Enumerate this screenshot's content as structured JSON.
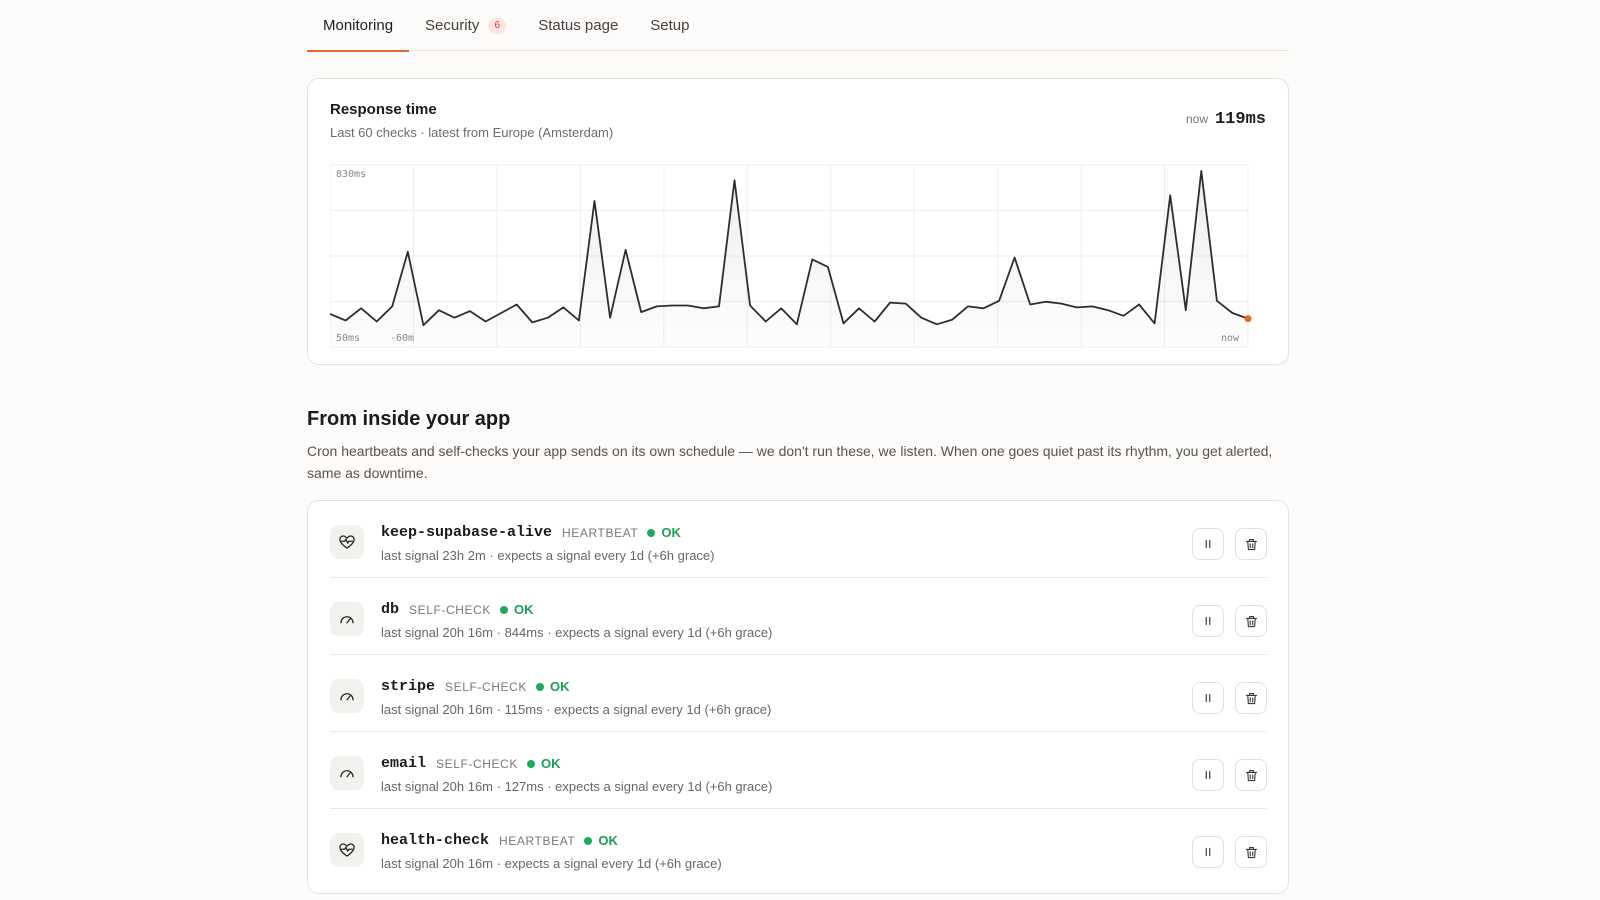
{
  "tabs": [
    {
      "label": "Monitoring",
      "active": true
    },
    {
      "label": "Security",
      "badge": "6"
    },
    {
      "label": "Status page"
    },
    {
      "label": "Setup"
    }
  ],
  "response_time": {
    "title": "Response time",
    "subtitle": "Last 60 checks · latest from Europe (Amsterdam)",
    "now_label": "now",
    "now_value": "119ms"
  },
  "chart_data": {
    "type": "line",
    "y_max_label": "830ms",
    "y_min_label": "50ms",
    "x_start_label": "-60m",
    "x_end_label": "now",
    "ylim": [
      50,
      830
    ],
    "grid": true,
    "values": [
      130,
      95,
      160,
      90,
      170,
      460,
      70,
      150,
      110,
      145,
      90,
      135,
      180,
      85,
      110,
      165,
      95,
      730,
      110,
      470,
      140,
      170,
      175,
      175,
      160,
      170,
      840,
      175,
      90,
      160,
      75,
      420,
      380,
      80,
      160,
      90,
      190,
      185,
      110,
      75,
      100,
      170,
      160,
      200,
      430,
      180,
      195,
      185,
      165,
      170,
      150,
      120,
      180,
      80,
      760,
      150,
      890,
      200,
      135,
      105
    ],
    "last_point_color": "#e4672d"
  },
  "section": {
    "title": "From inside your app",
    "description": "Cron heartbeats and self-checks your app sends on its own schedule — we don't run these, we listen. When one goes quiet past its rhythm, you get alerted, same as downtime."
  },
  "checks": [
    {
      "name": "keep-supabase-alive",
      "kind": "HEARTBEAT",
      "status": "OK",
      "icon": "heartbeat-icon",
      "detail": "last signal 23h 2m · expects a signal every 1d (+6h grace)"
    },
    {
      "name": "db",
      "kind": "SELF-CHECK",
      "status": "OK",
      "icon": "gauge-icon",
      "detail": "last signal 20h 16m · 844ms · expects a signal every 1d (+6h grace)"
    },
    {
      "name": "stripe",
      "kind": "SELF-CHECK",
      "status": "OK",
      "icon": "gauge-icon",
      "detail": "last signal 20h 16m · 115ms · expects a signal every 1d (+6h grace)"
    },
    {
      "name": "email",
      "kind": "SELF-CHECK",
      "status": "OK",
      "icon": "gauge-icon",
      "detail": "last signal 20h 16m · 127ms · expects a signal every 1d (+6h grace)"
    },
    {
      "name": "health-check",
      "kind": "HEARTBEAT",
      "status": "OK",
      "icon": "heartbeat-icon",
      "detail": "last signal 20h 16m · expects a signal every 1d (+6h grace)"
    }
  ],
  "colors": {
    "accent": "#e4672d",
    "ok": "#23a75f",
    "badge_bg": "#fbe3df",
    "badge_fg": "#d2402f"
  }
}
